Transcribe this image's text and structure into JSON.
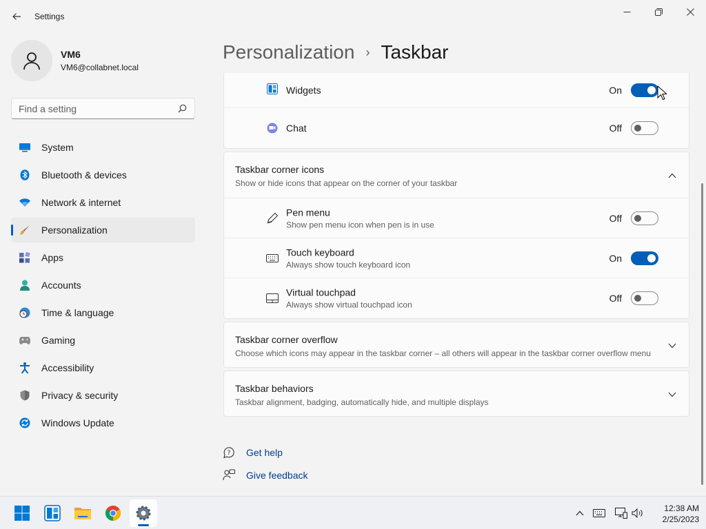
{
  "window": {
    "title": "Settings",
    "back_icon": "back-arrow-icon",
    "minimize_icon": "minimize-icon",
    "maximize_icon": "restore-icon",
    "close_icon": "close-icon"
  },
  "profile": {
    "name": "VM6",
    "email": "VM6@collabnet.local"
  },
  "search": {
    "placeholder": "Find a setting",
    "icon": "search-icon"
  },
  "sidebar": {
    "items": [
      {
        "label": "System",
        "icon": "system-icon",
        "active": false
      },
      {
        "label": "Bluetooth & devices",
        "icon": "bluetooth-icon",
        "active": false
      },
      {
        "label": "Network & internet",
        "icon": "wifi-icon",
        "active": false
      },
      {
        "label": "Personalization",
        "icon": "brush-icon",
        "active": true
      },
      {
        "label": "Apps",
        "icon": "apps-icon",
        "active": false
      },
      {
        "label": "Accounts",
        "icon": "accounts-icon",
        "active": false
      },
      {
        "label": "Time & language",
        "icon": "globe-clock-icon",
        "active": false
      },
      {
        "label": "Gaming",
        "icon": "gamepad-icon",
        "active": false
      },
      {
        "label": "Accessibility",
        "icon": "accessibility-icon",
        "active": false
      },
      {
        "label": "Privacy & security",
        "icon": "shield-icon",
        "active": false
      },
      {
        "label": "Windows Update",
        "icon": "update-icon",
        "active": false
      }
    ]
  },
  "header": {
    "parent": "Personalization",
    "separator": "›",
    "current": "Taskbar"
  },
  "taskbar_items": {
    "rows": [
      {
        "title": "Widgets",
        "icon": "widgets-icon",
        "state": "On",
        "on": true
      },
      {
        "title": "Chat",
        "icon": "chat-icon",
        "state": "Off",
        "on": false
      }
    ]
  },
  "corner_icons": {
    "title": "Taskbar corner icons",
    "description": "Show or hide icons that appear on the corner of your taskbar",
    "expanded": true,
    "rows": [
      {
        "title": "Pen menu",
        "description": "Show pen menu icon when pen is in use",
        "icon": "pen-icon",
        "state": "Off",
        "on": false
      },
      {
        "title": "Touch keyboard",
        "description": "Always show touch keyboard icon",
        "icon": "keyboard-icon",
        "state": "On",
        "on": true
      },
      {
        "title": "Virtual touchpad",
        "description": "Always show virtual touchpad icon",
        "icon": "touchpad-icon",
        "state": "Off",
        "on": false
      }
    ]
  },
  "corner_overflow": {
    "title": "Taskbar corner overflow",
    "description": "Choose which icons may appear in the taskbar corner – all others will appear in the taskbar corner overflow menu"
  },
  "behaviors": {
    "title": "Taskbar behaviors",
    "description": "Taskbar alignment, badging, automatically hide, and multiple displays"
  },
  "help": {
    "get_help": "Get help",
    "give_feedback": "Give feedback"
  },
  "system_taskbar": {
    "apps": [
      "start-icon",
      "widgets-icon",
      "file-explorer-icon",
      "chrome-icon",
      "settings-icon"
    ],
    "active_app": "settings-icon",
    "tray": [
      "chevron-up-icon",
      "keyboard-icon",
      "network-icon",
      "volume-icon"
    ],
    "time": "12:38 AM",
    "date": "2/25/2023"
  },
  "colors": {
    "accent": "#005fb8",
    "link": "#003e92",
    "background": "#f3f3f3",
    "card": "#fbfbfb"
  }
}
